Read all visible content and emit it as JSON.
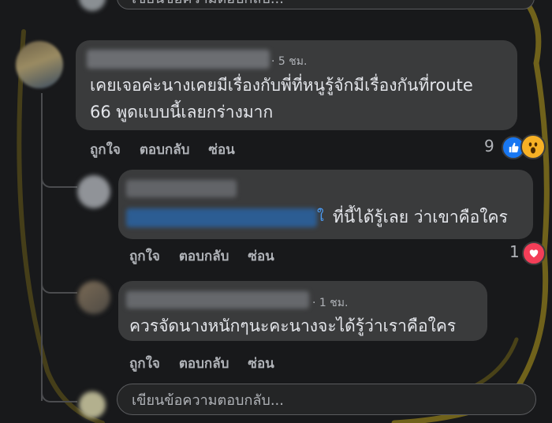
{
  "top_reply_input": {
    "placeholder": "เขียนข้อความตอบกลับ..."
  },
  "comments": [
    {
      "time": "· 5 ชม.",
      "text_line1": "เคยเจอค่ะนางเคยมีเรื่องกับพี่ที่หนูรู้จักมีเรื่องกันที่route",
      "text_line2": "66 พูดแบบนี้เลยกร่างมาก",
      "actions": {
        "like": "ถูกใจ",
        "reply": "ตอบกลับ",
        "hide": "ซ่อน"
      },
      "reaction_count": "9",
      "reactions": [
        "like-icon",
        "wow-icon"
      ]
    },
    {
      "time": "",
      "mention_label": "ใ",
      "text": "ที่นี้ได้รู้เลย ว่าเขาคือใคร",
      "actions": {
        "like": "ถูกใจ",
        "reply": "ตอบกลับ",
        "hide": "ซ่อน"
      },
      "reaction_count": "1",
      "reactions": [
        "love-icon"
      ]
    },
    {
      "time": "· 1 ชม.",
      "text": "ควรจัดนางหนักๆนะคะนางจะได้รู้ว่าเราคือใคร",
      "actions": {
        "like": "ถูกใจ",
        "reply": "ตอบกลับ",
        "hide": "ซ่อน"
      }
    }
  ],
  "bottom_reply_input": {
    "placeholder": "เขียนข้อความตอบกลับ..."
  },
  "colors": {
    "background": "#18191b",
    "bubble": "#3a3b3c",
    "secondary_text": "#b0b3b8",
    "like_blue": "#1877f2",
    "love_red": "#f33e58",
    "highlight_stroke": "#7a6a1c"
  }
}
